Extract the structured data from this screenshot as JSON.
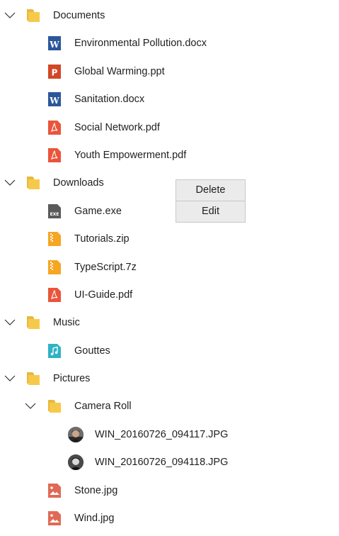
{
  "tree": {
    "documents": {
      "label": "Documents",
      "files": [
        {
          "label": "Environmental Pollution.docx",
          "icon": "word-doc-icon"
        },
        {
          "label": "Global Warming.ppt",
          "icon": "powerpoint-icon"
        },
        {
          "label": "Sanitation.docx",
          "icon": "word-doc-icon"
        },
        {
          "label": "Social Network.pdf",
          "icon": "pdf-icon"
        },
        {
          "label": "Youth Empowerment.pdf",
          "icon": "pdf-icon"
        }
      ]
    },
    "downloads": {
      "label": "Downloads",
      "files": [
        {
          "label": "Game.exe",
          "icon": "exe-icon"
        },
        {
          "label": "Tutorials.zip",
          "icon": "zip-icon"
        },
        {
          "label": "TypeScript.7z",
          "icon": "zip-icon"
        },
        {
          "label": "UI-Guide.pdf",
          "icon": "pdf-icon"
        }
      ]
    },
    "music": {
      "label": "Music",
      "files": [
        {
          "label": "Gouttes",
          "icon": "music-icon"
        }
      ]
    },
    "pictures": {
      "label": "Pictures",
      "camera_roll": {
        "label": "Camera Roll",
        "files": [
          {
            "label": "WIN_20160726_094117.JPG",
            "icon": "photo-thumbnail"
          },
          {
            "label": "WIN_20160726_094118.JPG",
            "icon": "photo-thumbnail"
          }
        ]
      },
      "files": [
        {
          "label": "Stone.jpg",
          "icon": "image-icon"
        },
        {
          "label": "Wind.jpg",
          "icon": "image-icon"
        }
      ]
    }
  },
  "context_menu": {
    "items": [
      "Delete",
      "Edit"
    ]
  },
  "colors": {
    "folder": "#f7c94b",
    "word": "#2b579a",
    "powerpoint": "#d24726",
    "pdf": "#e9553b",
    "exe": "#5a5a5a",
    "zip": "#f6a623",
    "music": "#2fb3c4",
    "image": "#e06a55"
  }
}
